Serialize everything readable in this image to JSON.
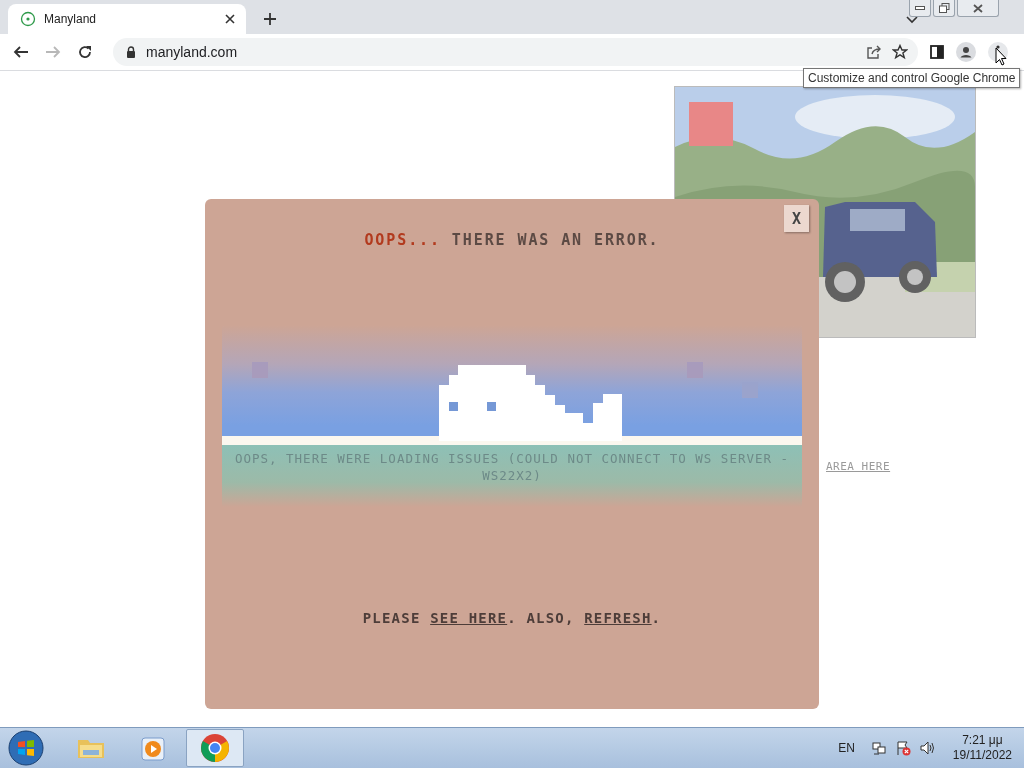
{
  "browser": {
    "tabs": [
      {
        "title": "Manyland",
        "selected": true
      }
    ],
    "nav": [
      {
        "kind": "back",
        "disabled": false
      },
      {
        "kind": "forward",
        "disabled": true
      },
      {
        "kind": "reload",
        "disabled": false
      }
    ],
    "address": "manyland.com",
    "tooltip": "Customize and control Google Chrome"
  },
  "page": {
    "background_link": "AREA HERE",
    "dialog": {
      "close_label": "X",
      "title_prefix": "OOPS...",
      "title": "THERE WAS AN ERROR.",
      "message": "OOPS, THERE WERE LOADING ISSUES (COULD NOT CONNECT TO WS SERVER - WS22X2)",
      "footer": [
        {
          "kind": "text",
          "text": "PLEASE "
        },
        {
          "kind": "link",
          "text": "SEE HERE"
        },
        {
          "kind": "text",
          "text": ". ALSO, "
        },
        {
          "kind": "link",
          "text": "REFRESH"
        },
        {
          "kind": "text",
          "text": "."
        }
      ]
    }
  },
  "taskbar": {
    "apps": [
      {
        "kind": "explorer",
        "selected": false
      },
      {
        "kind": "media",
        "selected": false
      },
      {
        "kind": "chrome",
        "selected": true
      }
    ],
    "language": "EN",
    "time": "7:21 μμ",
    "date": "19/11/2022"
  }
}
